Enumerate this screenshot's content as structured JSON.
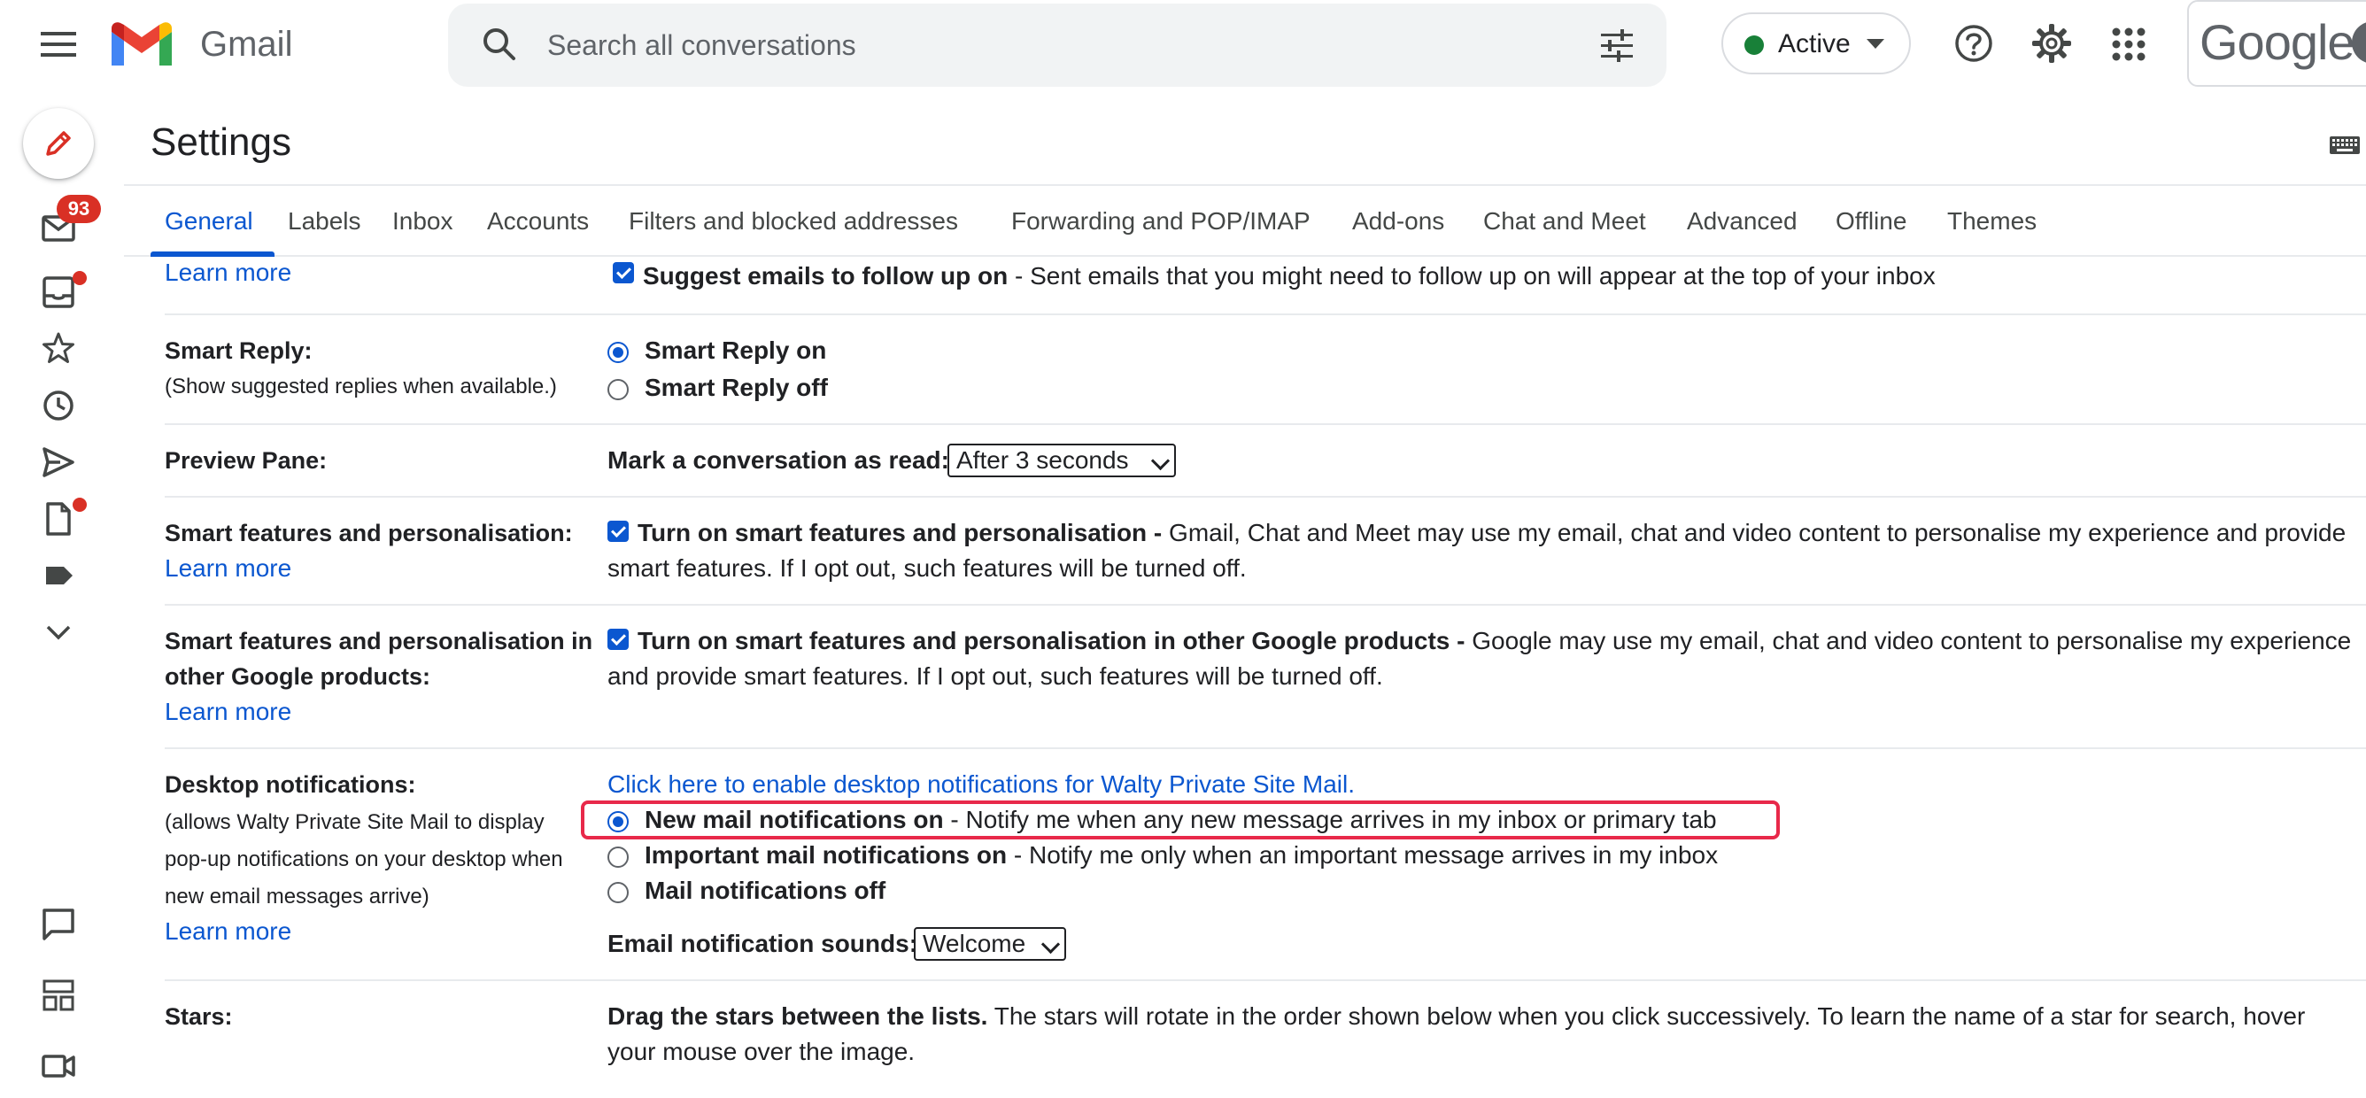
{
  "header": {
    "app_name": "Gmail",
    "search_placeholder": "Search all conversations",
    "status_label": "Active",
    "google_wordmark": "Google"
  },
  "rail": {
    "mail_badge": "93"
  },
  "settings": {
    "title": "Settings",
    "tabs": [
      "General",
      "Labels",
      "Inbox",
      "Accounts",
      "Filters and blocked addresses",
      "Forwarding and POP/IMAP",
      "Add-ons",
      "Chat and Meet",
      "Advanced",
      "Offline",
      "Themes"
    ],
    "active_tab": "General"
  },
  "rows": {
    "follow_up": {
      "learn_more": "Learn more",
      "checkbox_label": "Suggest emails to follow up on",
      "description": " - Sent emails that you might need to follow up on will appear at the top of your inbox",
      "checked": true
    },
    "smart_reply": {
      "label": "Smart Reply:",
      "sublabel": "(Show suggested replies when available.)",
      "option_on": "Smart Reply on",
      "option_off": "Smart Reply off",
      "selected": "on"
    },
    "preview_pane": {
      "label": "Preview Pane:",
      "mark_read_label": "Mark a conversation as read:",
      "mark_read_value": "After 3 seconds"
    },
    "smart_features": {
      "label": "Smart features and personalisation:",
      "learn_more": "Learn more",
      "checkbox_label": "Turn on smart features and personalisation -",
      "description_line1": " Gmail, Chat and Meet may use my email, chat and video content to personalise my experience and provide",
      "description_line2": "smart features. If I opt out, such features will be turned off.",
      "checked": true
    },
    "smart_features_other": {
      "label_line1": "Smart features and personalisation in",
      "label_line2": "other Google products:",
      "learn_more": "Learn more",
      "checkbox_label": "Turn on smart features and personalisation in other Google products -",
      "description_line1": " Google may use my email, chat and video content to personalise my experience",
      "description_line2": "and provide smart features. If I opt out, such features will be turned off.",
      "checked": true
    },
    "desktop_notifications": {
      "label": "Desktop notifications:",
      "sublabel_line1": "(allows Walty Private Site Mail to display",
      "sublabel_line2": "pop-up notifications on your desktop when",
      "sublabel_line3": "new email messages arrive)",
      "learn_more": "Learn more",
      "enable_link": "Click here to enable desktop notifications for Walty Private Site Mail.",
      "opt_new_bold": "New mail notifications on",
      "opt_new_desc": " - Notify me when any new message arrives in my inbox or primary tab",
      "opt_important_bold": "Important mail notifications on",
      "opt_important_desc": " - Notify me only when an important message arrives in my inbox",
      "opt_off_bold": "Mail notifications off",
      "selected": "new",
      "sounds_label": "Email notification sounds:",
      "sounds_value": "Welcome"
    },
    "stars": {
      "label": "Stars:",
      "drag_bold": "Drag the stars between the lists.",
      "drag_desc_line1": "  The stars will rotate in the order shown below when you click successively. To learn the name of a star for search, hover",
      "drag_desc_line2": "your mouse over the image."
    }
  },
  "colors": {
    "accent_blue": "#0b57d0",
    "badge_red": "#d93025",
    "highlight_red": "#e8294a",
    "status_green": "#188038"
  },
  "icons": {
    "menu": "menu-icon",
    "search": "search-icon",
    "search_options": "tune-icon",
    "help": "help-icon",
    "settings": "gear-icon",
    "apps": "apps-grid-icon",
    "compose": "pencil-icon",
    "rail": [
      "mail-icon",
      "inbox-icon",
      "star-icon",
      "clock-icon",
      "send-icon",
      "draft-icon",
      "label-icon",
      "chevron-down-icon",
      "chat-icon",
      "spaces-icon",
      "meet-icon"
    ]
  }
}
